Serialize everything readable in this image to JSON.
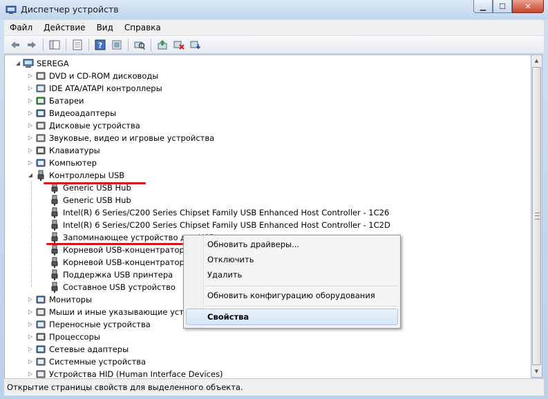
{
  "window": {
    "title": "Диспетчер устройств"
  },
  "caption_buttons": {
    "minimize": "▁",
    "maximize": "☐",
    "close": "✕"
  },
  "menu": [
    "Файл",
    "Действие",
    "Вид",
    "Справка"
  ],
  "toolbar": [
    "back-arrow-icon",
    "forward-arrow-icon",
    "console-tree-icon",
    "properties-icon",
    "help-icon",
    "show-hide-icon",
    "scan-hardware-icon",
    "update-driver-icon",
    "disable-device-icon",
    "uninstall-device-icon"
  ],
  "tree": {
    "root": "SEREGA",
    "categories": [
      "DVD и CD-ROM дисководы",
      "IDE ATA/ATAPI контроллеры",
      "Батареи",
      "Видеоадаптеры",
      "Дисковые устройства",
      "Звуковые, видео и игровые устройства",
      "Клавиатуры",
      "Компьютер",
      "Контроллеры USB"
    ],
    "usb_children": [
      "Generic USB Hub",
      "Generic USB Hub",
      "Intel(R) 6 Series/C200 Series Chipset Family USB Enhanced Host Controller - 1C26",
      "Intel(R) 6 Series/C200 Series Chipset Family USB Enhanced Host Controller - 1C2D",
      "Запоминающее устройство для USB",
      "Корневой USB-концентратор",
      "Корневой USB-концентратор",
      "Поддержка USB принтера",
      "Составное USB устройство"
    ],
    "more_categories": [
      "Мониторы",
      "Мыши и иные указывающие устройства",
      "Переносные устройства",
      "Процессоры",
      "Сетевые адаптеры",
      "Системные устройства",
      "Устройства HID (Human Interface Devices)"
    ]
  },
  "context_menu": {
    "update_drivers": "Обновить драйверы...",
    "disable": "Отключить",
    "delete": "Удалить",
    "scan_hardware": "Обновить конфигурацию оборудования",
    "properties": "Свойства"
  },
  "status": "Открытие страницы свойств для выделенного объекта.",
  "colors": {
    "annotation_red": "#d3141b",
    "highlight": "#d6e6f8"
  }
}
